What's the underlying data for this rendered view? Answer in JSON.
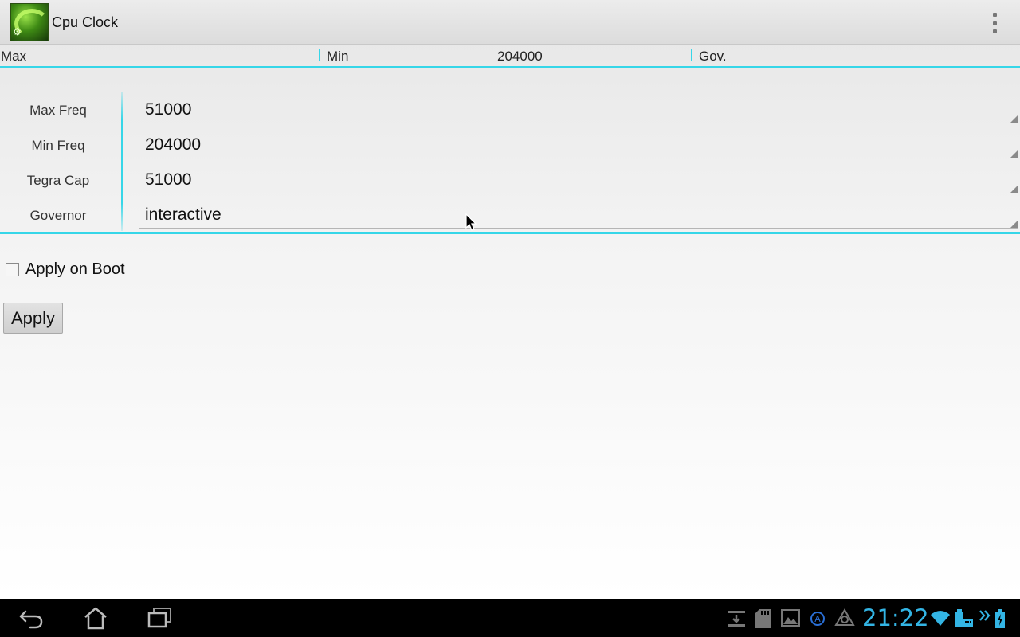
{
  "app": {
    "title": "Cpu Clock",
    "icon": "cpu-clock-app-icon"
  },
  "summary": {
    "max_label": "Max",
    "min_label": "Min",
    "min_value": "204000",
    "gov_label": "Gov."
  },
  "settings": [
    {
      "label": "Max Freq",
      "value": "51000"
    },
    {
      "label": "Min Freq",
      "value": "204000"
    },
    {
      "label": "Tegra Cap",
      "value": "51000"
    },
    {
      "label": "Governor",
      "value": "interactive"
    }
  ],
  "apply_on_boot": {
    "label": "Apply on Boot",
    "checked": false
  },
  "apply_button": {
    "label": "Apply"
  },
  "status_bar": {
    "time": "21:22",
    "icons": [
      "download-icon",
      "sd-card-icon",
      "gallery-icon",
      "app-a-icon",
      "triangle-app-icon",
      "wifi-icon",
      "keyboard-battery-icon",
      "more-chevron-icon",
      "battery-charging-icon"
    ]
  },
  "nav_icons": [
    "back-icon",
    "home-icon",
    "recent-apps-icon"
  ],
  "colors": {
    "accent": "#36d6e8",
    "clock": "#33b5e5",
    "navbar": "#000000"
  }
}
